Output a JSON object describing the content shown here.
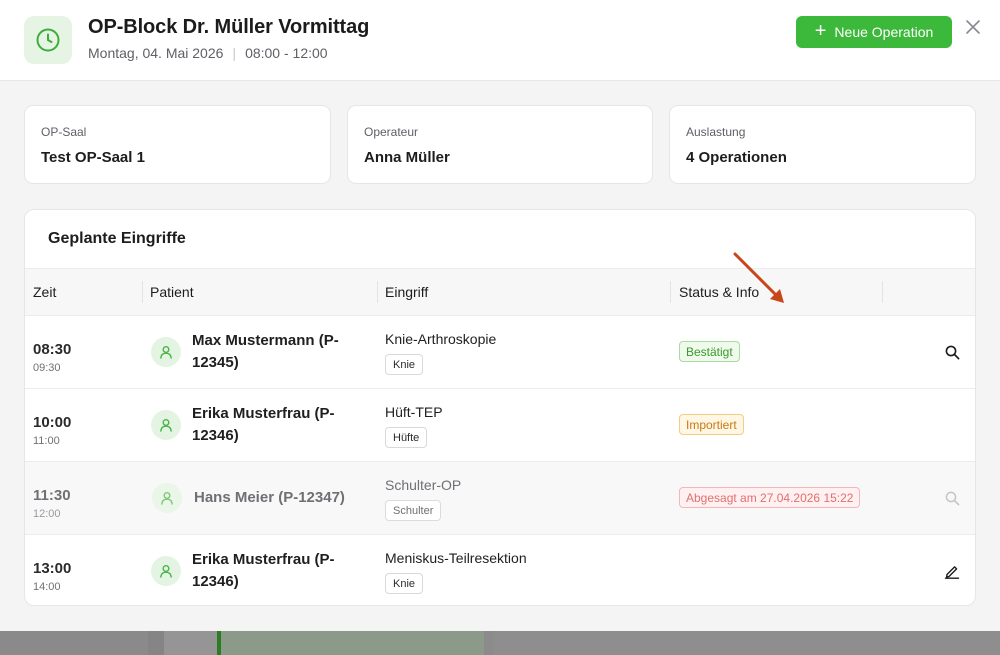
{
  "header": {
    "title": "OP-Block Dr. Müller Vormittag",
    "date": "Montag, 04. Mai 2026",
    "separator": "|",
    "time_range": "08:00 - 12:00",
    "new_button_label": "Neue Operation",
    "new_button_icon": "plus-icon",
    "close_icon": "close-icon",
    "block_icon": "clock-icon"
  },
  "info": {
    "room": {
      "label": "OP-Saal",
      "value": "Test OP-Saal 1"
    },
    "surgeon": {
      "label": "Operateur",
      "value": "Anna Müller"
    },
    "utilization": {
      "label": "Auslastung",
      "value": "4 Operationen"
    }
  },
  "table": {
    "title": "Geplante Eingriffe",
    "columns": [
      "Zeit",
      "Patient",
      "Eingriff",
      "Status & Info"
    ],
    "rows": [
      {
        "start": "08:30",
        "end": "09:30",
        "patient": "Max Mustermann (P-12345)",
        "procedure": "Knie-Arthroskopie",
        "tag": "Knie",
        "status": "Bestätigt",
        "action_icon": "search-icon"
      },
      {
        "start": "10:00",
        "end": "11:00",
        "patient": "Erika Musterfrau (P-12346)",
        "procedure": "Hüft-TEP",
        "tag": "Hüfte",
        "status": "Importiert",
        "action_icon": ""
      },
      {
        "start": "11:30",
        "end": "12:00",
        "patient": "Hans Meier (P-12347)",
        "procedure": "Schulter-OP",
        "tag": "Schulter",
        "status": "Abgesagt am 27.04.2026 15:22",
        "action_icon": "search-icon"
      },
      {
        "start": "13:00",
        "end": "14:00",
        "patient": "Erika Musterfrau (P-12346)",
        "procedure": "Meniskus-Teilresektion",
        "tag": "Knie",
        "status": "",
        "action_icon": "edit-icon"
      }
    ]
  },
  "colors": {
    "accent": "#3cb83b",
    "status_confirmed": "#3a9a2c",
    "status_imported": "#c77a12",
    "status_cancelled": "#e0706e",
    "annotation_arrow": "#c8461a"
  }
}
